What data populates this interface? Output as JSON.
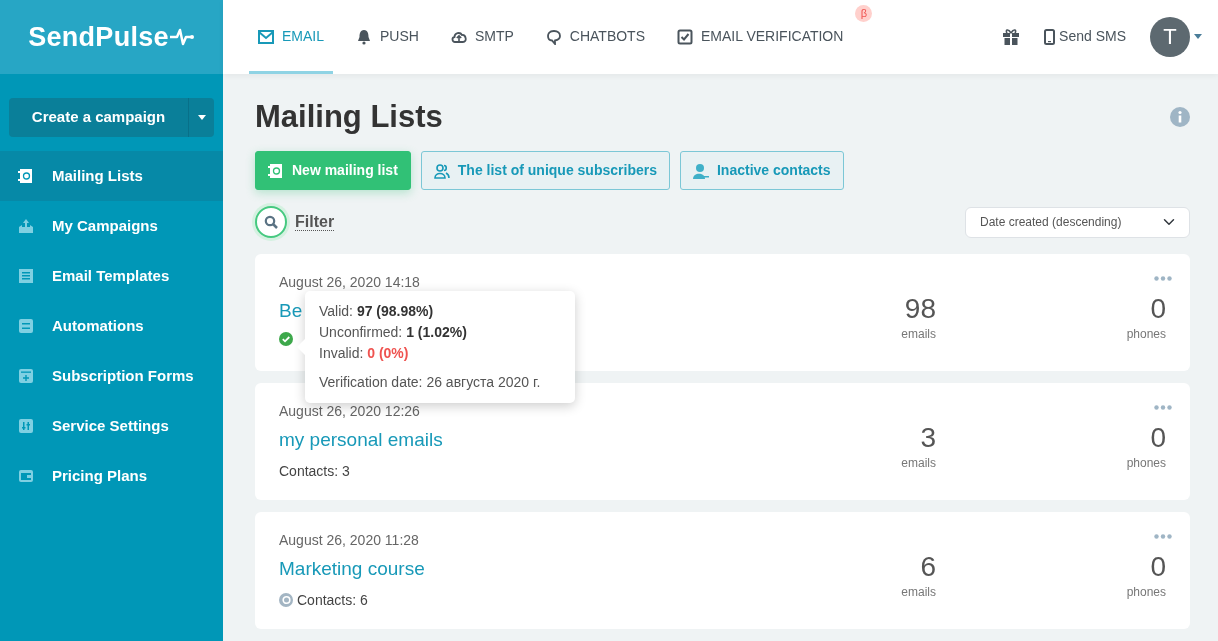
{
  "logo": {
    "text": "SendPulse"
  },
  "create_button": {
    "label": "Create a campaign"
  },
  "sidebar": {
    "items": [
      {
        "label": "Mailing Lists",
        "selected": true
      },
      {
        "label": "My Campaigns",
        "selected": false
      },
      {
        "label": "Email Templates",
        "selected": false
      },
      {
        "label": "Automations",
        "selected": false
      },
      {
        "label": "Subscription Forms",
        "selected": false
      },
      {
        "label": "Service Settings",
        "selected": false
      },
      {
        "label": "Pricing Plans",
        "selected": false
      }
    ]
  },
  "tabs": [
    {
      "label": "EMAIL",
      "selected": true
    },
    {
      "label": "PUSH",
      "selected": false
    },
    {
      "label": "SMTP",
      "selected": false
    },
    {
      "label": "CHATBOTS",
      "selected": false
    },
    {
      "label": "EMAIL VERIFICATION",
      "selected": false,
      "badge": "β"
    }
  ],
  "header_right": {
    "sms_label": "Send SMS",
    "avatar": "T"
  },
  "page": {
    "title": "Mailing Lists",
    "actions": [
      {
        "label": "New mailing list",
        "kind": "primary"
      },
      {
        "label": "The list of unique subscribers",
        "kind": "outline"
      },
      {
        "label": "Inactive contacts",
        "kind": "outline"
      }
    ],
    "filter_label": "Filter",
    "sort": {
      "value": "Date created (descending)"
    }
  },
  "lists": [
    {
      "date": "August 26, 2020 14:18",
      "name": "Be",
      "kind": "verified",
      "emails": "98",
      "emails_label": "emails",
      "phones": "0",
      "phones_label": "phones"
    },
    {
      "date": "August 26, 2020 12:26",
      "name": "my personal emails",
      "kind": "plain",
      "contacts": "Contacts: 3",
      "emails": "3",
      "emails_label": "emails",
      "phones": "0",
      "phones_label": "phones"
    },
    {
      "date": "August 26, 2020 11:28",
      "name": "Marketing course",
      "kind": "pending",
      "contacts": "Contacts: 6",
      "emails": "6",
      "emails_label": "emails",
      "phones": "0",
      "phones_label": "phones"
    }
  ],
  "tooltip": {
    "lines": [
      {
        "label": "Valid:",
        "value": "97 (98.98%)",
        "kind": "normal"
      },
      {
        "label": "Unconfirmed:",
        "value": "1 (1.02%)",
        "kind": "normal"
      },
      {
        "label": "Invalid:",
        "value": "0 (0%)",
        "kind": "danger"
      }
    ],
    "date": "Verification date: 26 августа 2020 г."
  }
}
